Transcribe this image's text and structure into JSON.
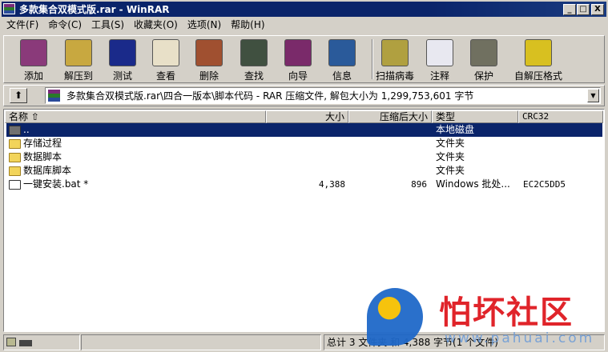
{
  "window": {
    "title": "多款集合双模式版.rar - WinRAR",
    "min": "_",
    "max": "□",
    "close": "X"
  },
  "menu": [
    "文件(F)",
    "命令(C)",
    "工具(S)",
    "收藏夹(O)",
    "选项(N)",
    "帮助(H)"
  ],
  "toolbar": [
    {
      "label": "添加",
      "icon": "add-archive-icon",
      "color": "#8a3a7a"
    },
    {
      "label": "解压到",
      "icon": "extract-icon",
      "color": "#c8a840"
    },
    {
      "label": "测试",
      "icon": "test-icon",
      "color": "#1a2a8a"
    },
    {
      "label": "查看",
      "icon": "view-icon",
      "color": "#e8e0c8"
    },
    {
      "label": "删除",
      "icon": "delete-icon",
      "color": "#a05030"
    },
    {
      "label": "查找",
      "icon": "find-icon",
      "color": "#405040"
    },
    {
      "label": "向导",
      "icon": "wizard-icon",
      "color": "#7a2a6a"
    },
    {
      "label": "信息",
      "icon": "info-icon",
      "color": "#2a5a9a"
    },
    {
      "label": "扫描病毒",
      "icon": "virus-scan-icon",
      "color": "#b0a040"
    },
    {
      "label": "注释",
      "icon": "comment-icon",
      "color": "#e8e8f0"
    },
    {
      "label": "保护",
      "icon": "protect-icon",
      "color": "#707060"
    },
    {
      "label": "自解压格式",
      "icon": "sfx-icon",
      "color": "#d8c020"
    }
  ],
  "address": {
    "path": "多款集合双模式版.rar\\四合一版本\\脚本代码 - RAR 压缩文件, 解包大小为 1,299,753,601 字节",
    "up": "⬆",
    "dropdown": "▼"
  },
  "columns": {
    "name": "名称  ⇧",
    "size": "大小",
    "packed": "压缩后大小",
    "type": "类型",
    "crc": "CRC32"
  },
  "rows": [
    {
      "name": "..",
      "size": "",
      "packed": "",
      "type": "本地磁盘",
      "crc": "",
      "kind": "parent"
    },
    {
      "name": "存储过程",
      "size": "",
      "packed": "",
      "type": "文件夹",
      "crc": "",
      "kind": "folder"
    },
    {
      "name": "数据脚本",
      "size": "",
      "packed": "",
      "type": "文件夹",
      "crc": "",
      "kind": "folder"
    },
    {
      "name": "数据库脚本",
      "size": "",
      "packed": "",
      "type": "文件夹",
      "crc": "",
      "kind": "folder"
    },
    {
      "name": "一键安装.bat *",
      "size": "4,388",
      "packed": "896",
      "type": "Windows 批处...",
      "crc": "EC2C5DD5",
      "kind": "file"
    }
  ],
  "status": {
    "summary": "总计 3 文件夹 和 4,388 字节(1 个文件)"
  },
  "watermark": {
    "name": "怕坏社区",
    "url": "www.pahuai.com"
  }
}
